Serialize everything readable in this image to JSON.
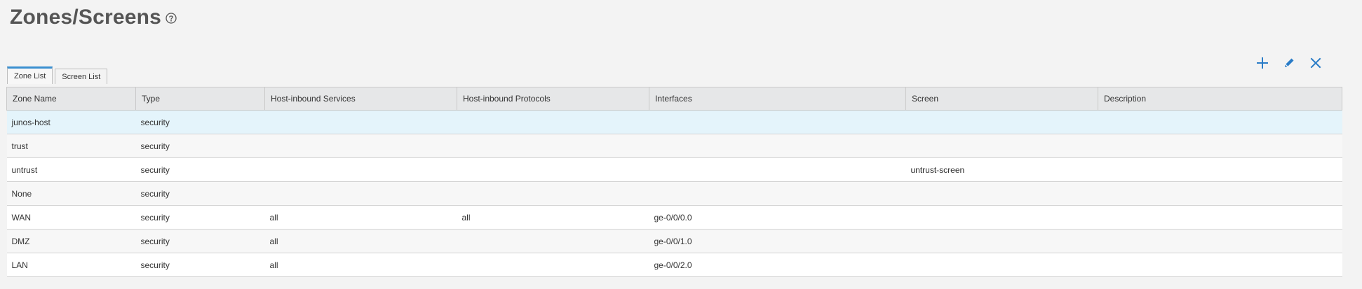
{
  "page": {
    "title": "Zones/Screens"
  },
  "icons": {
    "help": "help-circle-icon",
    "add": "plus-icon",
    "edit": "pencil-icon",
    "delete": "close-icon",
    "accent_color": "#2a7cc7"
  },
  "tabs": [
    {
      "label": "Zone List",
      "active": true
    },
    {
      "label": "Screen List",
      "active": false
    }
  ],
  "table": {
    "headers": [
      "Zone Name",
      "Type",
      "Host-inbound Services",
      "Host-inbound Protocols",
      "Interfaces",
      "Screen",
      "Description"
    ],
    "rows": [
      [
        "junos-host",
        "security",
        "",
        "",
        "",
        "",
        ""
      ],
      [
        "trust",
        "security",
        "",
        "",
        "",
        "",
        ""
      ],
      [
        "untrust",
        "security",
        "",
        "",
        "",
        "untrust-screen",
        ""
      ],
      [
        "None",
        "security",
        "",
        "",
        "",
        "",
        ""
      ],
      [
        "WAN",
        "security",
        "all",
        "all",
        "ge-0/0/0.0",
        "",
        ""
      ],
      [
        "DMZ",
        "security",
        "all",
        "",
        "ge-0/0/1.0",
        "",
        ""
      ],
      [
        "LAN",
        "security",
        "all",
        "",
        "ge-0/0/2.0",
        "",
        ""
      ]
    ]
  }
}
